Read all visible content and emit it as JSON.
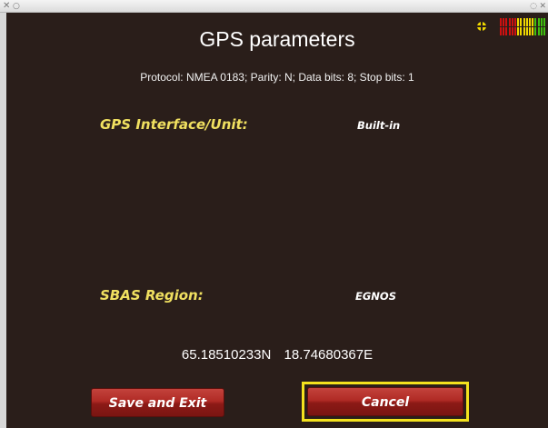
{
  "window": {
    "titlebar_left_glyphs": [
      "✕",
      "○"
    ],
    "titlebar_right_glyphs": [
      "◌",
      "✕"
    ]
  },
  "page": {
    "title": "GPS parameters",
    "protocol_line": "Protocol: NMEA 0183; Parity: N; Data bits: 8; Stop bits: 1"
  },
  "status": {
    "gps_fix_icon": "crosshair-dot-icon",
    "gps_fix_color": "#f0d800",
    "signal_bars": {
      "top_row": [
        "#d01010",
        "#d01010",
        "#d01010",
        "#d01010",
        "#d01010",
        "#d01010",
        "#f0d800",
        "#f0d800",
        "#f0d800",
        "#f0d800",
        "#f0d800",
        "#f0d800",
        "#40c010",
        "#40c010",
        "#40c010",
        "#40c010"
      ],
      "bottom_row": [
        "#d01010",
        "#d01010",
        "#d01010",
        "#d01010",
        "#d01010",
        "#d01010",
        "#f0d800",
        "#f0d800",
        "#f0d800",
        "#f0d800",
        "#f0d800",
        "#f0d800",
        "#40c010",
        "#40c010",
        "#40c010",
        "#40c010"
      ]
    }
  },
  "settings": {
    "gps_interface_label": "GPS Interface/Unit:",
    "gps_interface_value": "Built-in",
    "sbas_region_label": "SBAS Region:",
    "sbas_region_value": "EGNOS"
  },
  "position": {
    "latitude": "65.18510233N",
    "longitude": "18.74680367E"
  },
  "buttons": {
    "save_label": "Save and Exit",
    "cancel_label": "Cancel",
    "focus_color": "#f4e21e"
  },
  "colors": {
    "background": "#2a1e1a",
    "label_yellow": "#f0e060",
    "button_red": "#b02a25"
  }
}
